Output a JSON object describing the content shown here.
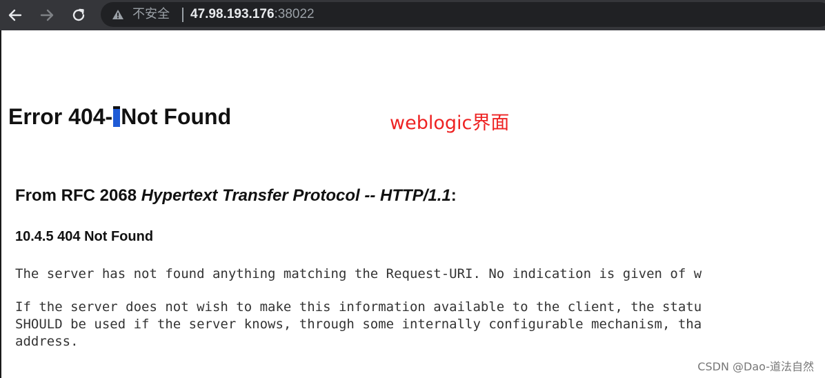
{
  "browser": {
    "security_label": "不安全",
    "url_host": "47.98.193.176",
    "url_port": ":38022",
    "icons": [
      "back-arrow-icon",
      "forward-arrow-icon",
      "reload-icon",
      "warning-icon"
    ]
  },
  "page": {
    "title_part1": "Error 404-",
    "title_part2": "Not Found",
    "annotation": "weblogic界面",
    "rfc_prefix": "From RFC 2068 ",
    "rfc_italic": "Hypertext Transfer Protocol -- HTTP/1.1",
    "rfc_suffix": ":",
    "section_heading": "10.4.5 404 Not Found",
    "paragraph1": "The server has not found anything matching the Request-URI. No indication is given of w",
    "paragraph2_line1": "If the server does not wish to make this information available to the client, the statu",
    "paragraph2_line2": "SHOULD be used if the server knows, through some internally configurable mechanism, tha",
    "paragraph2_line3": "address."
  },
  "watermark": "CSDN @Dao-道法自然",
  "colors": {
    "toolbar_bg": "#35363a",
    "omnibox_bg": "#202124",
    "annotation_red": "#ee2222",
    "selection_blue": "#1f5bd6"
  }
}
